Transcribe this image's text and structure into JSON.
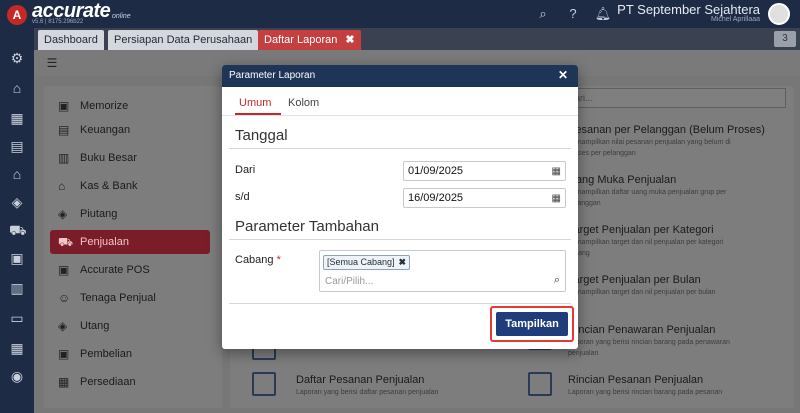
{
  "app": {
    "logo_letter": "A",
    "logo_text": "accurate",
    "logo_sub": "v5.6 | 8175.296b22",
    "logo_online": "online",
    "company": "PT September Sejahtera",
    "user": "Michel Aprillaaa"
  },
  "tabs": [
    {
      "label": "Dashboard"
    },
    {
      "label": "Persiapan Data Perusahaan"
    },
    {
      "label": "Daftar Laporan"
    }
  ],
  "tab_close": "✖",
  "tab_count": "3",
  "left_menu": [
    {
      "label": "Memorize"
    },
    {
      "label": "Keuangan"
    },
    {
      "label": "Buku Besar"
    },
    {
      "label": "Kas & Bank"
    },
    {
      "label": "Piutang"
    },
    {
      "label": "Penjualan"
    },
    {
      "label": "Accurate POS"
    },
    {
      "label": "Tenaga Penjual"
    },
    {
      "label": "Utang"
    },
    {
      "label": "Pembelian"
    },
    {
      "label": "Persediaan"
    }
  ],
  "right_search_placeholder": "ari...",
  "reports": [
    {
      "title": "Pesanan per Pelanggan (Belum Proses)",
      "desc1": "menampilkan nilai pesanan penjualan yang belum di",
      "desc2": "proses per pelanggan"
    },
    {
      "title": "Uang Muka Penjualan",
      "desc1": "menampilkan daftar uang muka penjualan grup per",
      "desc2": "pelanggan"
    },
    {
      "title": "Target Penjualan per Kategori",
      "desc1": "menampilkan target dan nil penjualan per kategori",
      "desc2": "barang"
    },
    {
      "title": "Target Penjualan per Bulan",
      "desc1": "menampilkan target dan nil penjualan per bulan",
      "desc2": ""
    },
    {
      "title": "Rincian Penawaran Penjualan",
      "desc1": "Laporan yang berisi rincian barang pada penawaran",
      "desc2": "penjualan"
    },
    {
      "title": "Daftar Pesanan Penjualan",
      "desc1": "Laporan yang berisi daftar pesanan penjualan",
      "desc2": ""
    },
    {
      "title": "Rincian Pesanan Penjualan",
      "desc1": "Laporan yang berisi rincian barang pada pesanan",
      "desc2": ""
    }
  ],
  "modal": {
    "title": "Parameter Laporan",
    "close": "✕",
    "tab_umum": "Umum",
    "tab_kolom": "Kolom",
    "section_tanggal": "Tanggal",
    "label_dari": "Dari",
    "value_dari": "01/09/2025",
    "label_sd": "s/d",
    "value_sd": "16/09/2025",
    "section_tambahan": "Parameter Tambahan",
    "label_cabang": "Cabang",
    "required_mark": "*",
    "chip_value": "[Semua Cabang]",
    "chip_remove": "✖",
    "cari_placeholder": "Cari/Pilih...",
    "button_tampilkan": "Tampilkan"
  },
  "colors": {
    "header": "#1e2b45",
    "modal_header": "#1f3558",
    "accent_red": "#c62828",
    "primary_button": "#1f3d7a",
    "highlight_border": "#e53935"
  }
}
